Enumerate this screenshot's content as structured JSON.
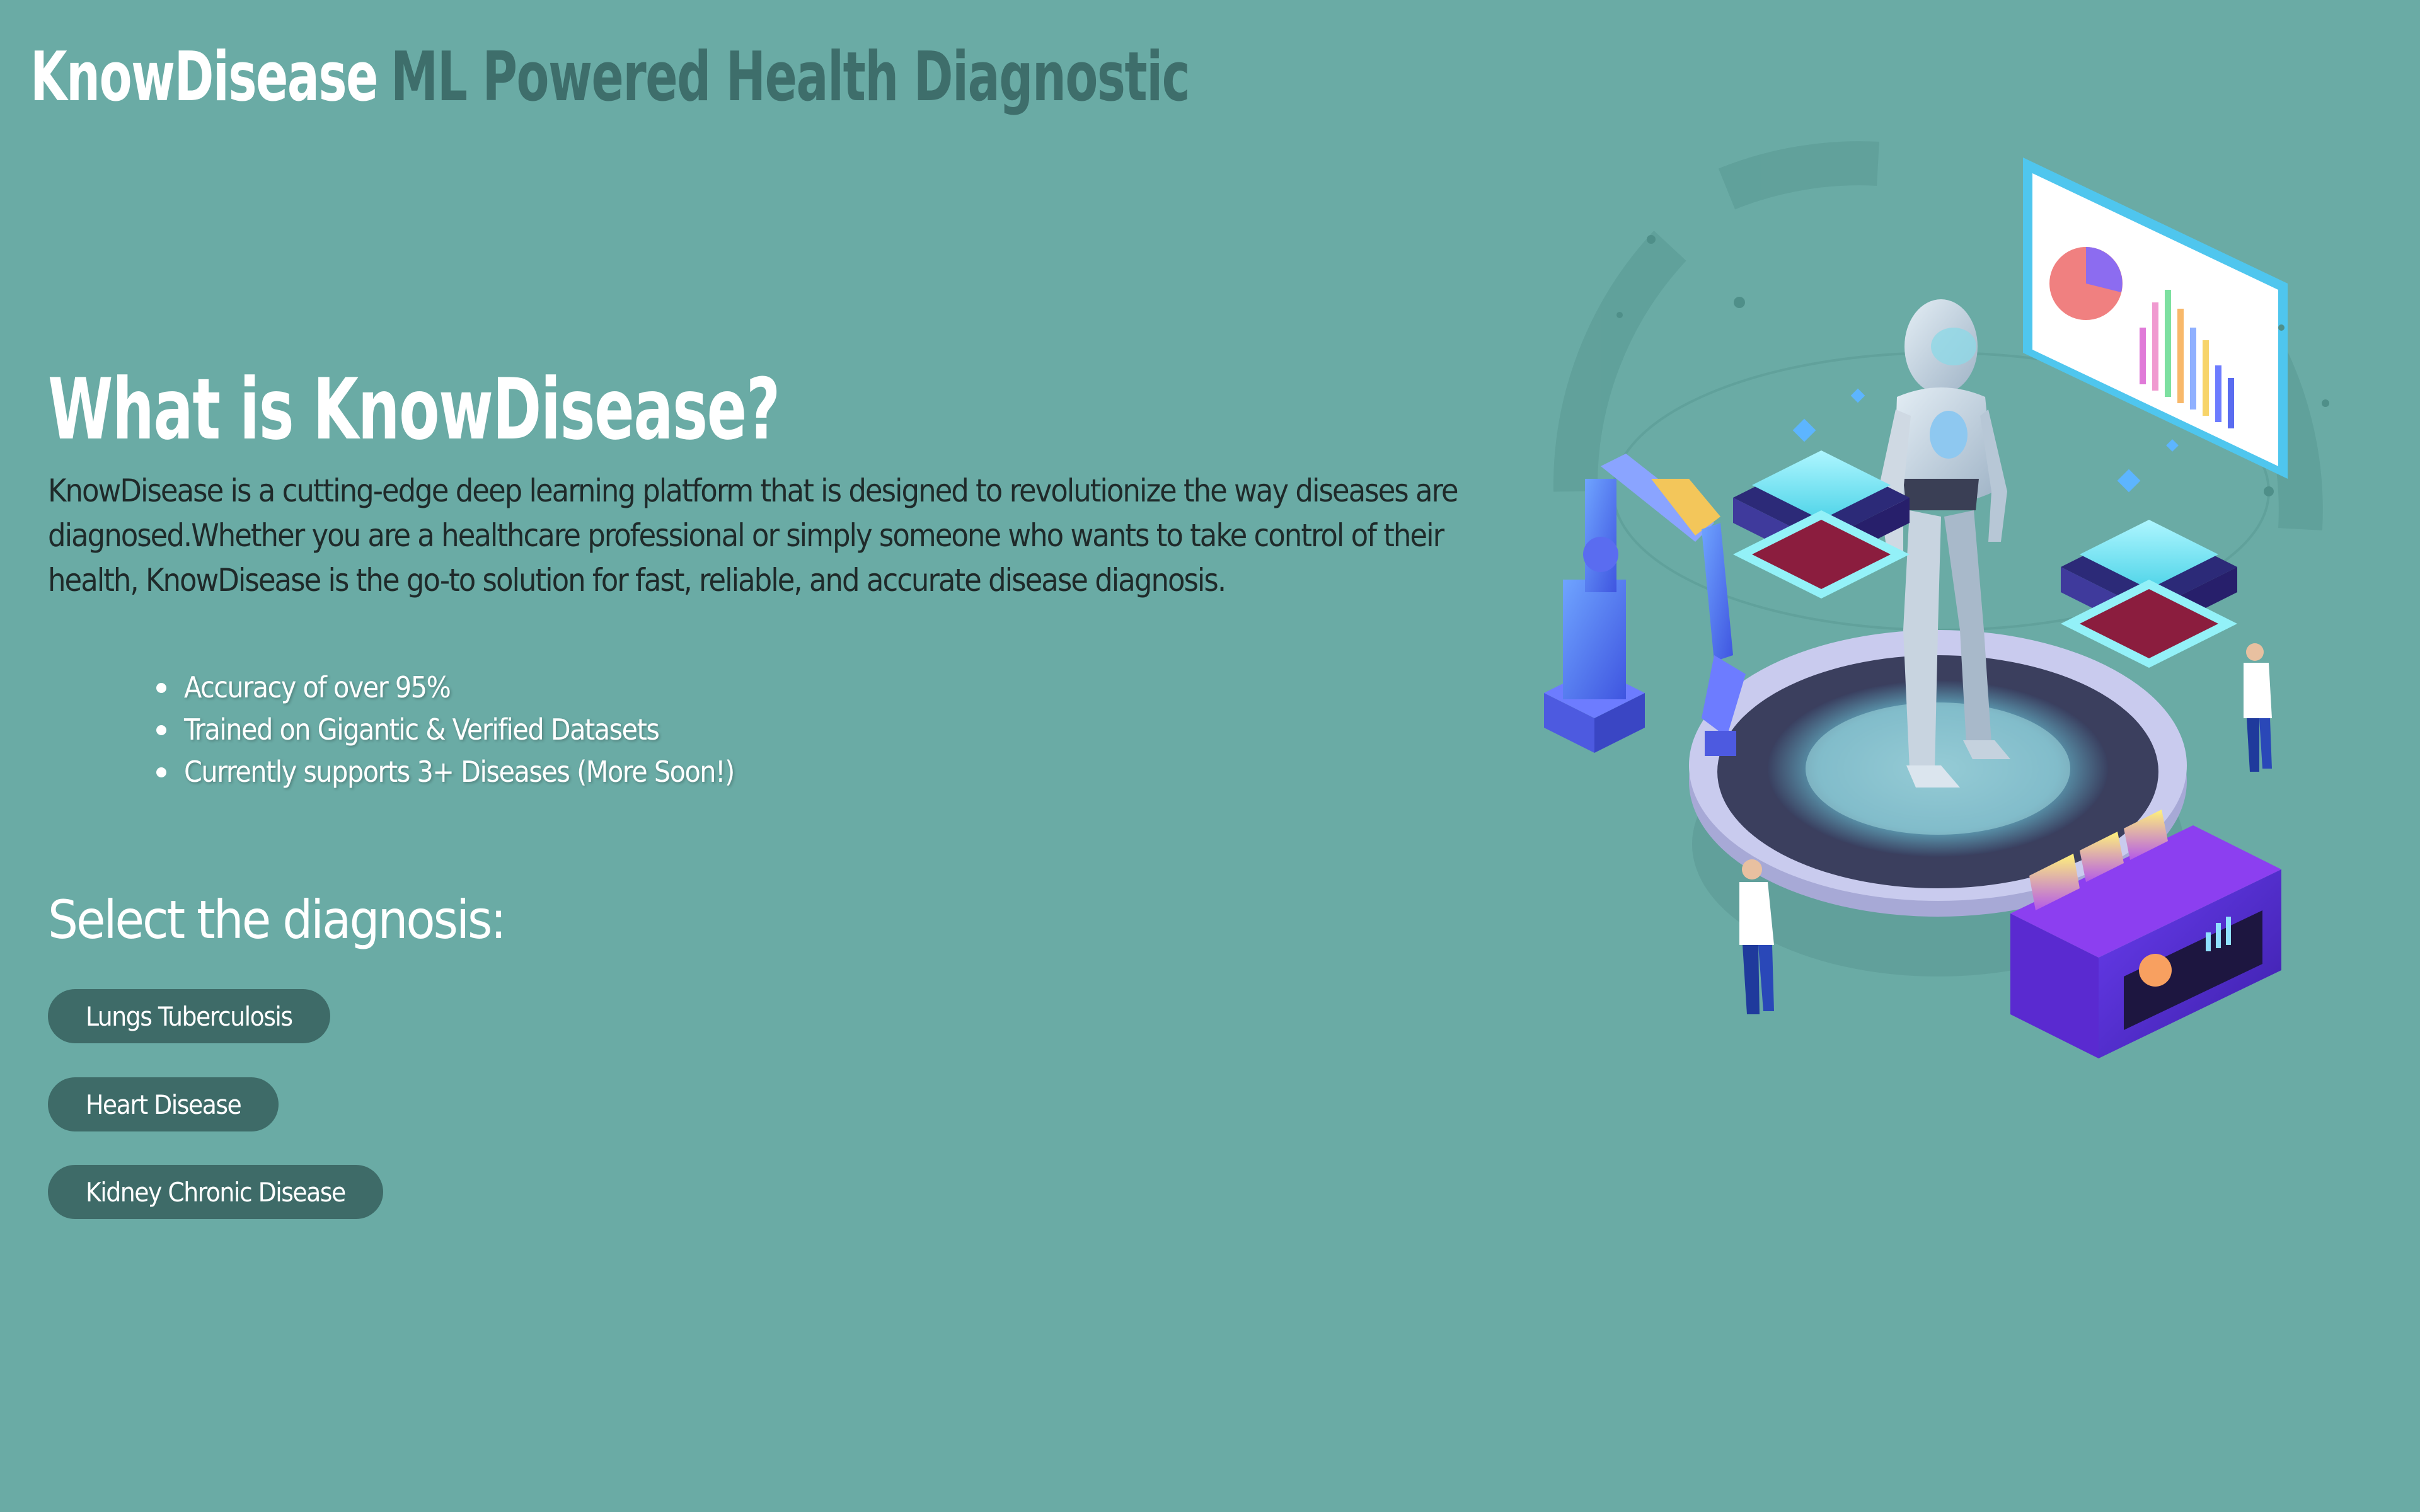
{
  "header": {
    "brand": "KnowDisease",
    "tagline": "ML Powered Health Diagnostic"
  },
  "intro": {
    "title": "What is KnowDisease?",
    "text": "KnowDisease is a cutting-edge deep learning platform that is designed to revolutionize the way diseases are diagnosed.Whether you are a healthcare professional or simply someone who wants to take control of their health, KnowDisease is the go-to solution for fast, reliable, and accurate disease diagnosis."
  },
  "features": [
    "Accuracy of over 95%",
    "Trained on Gigantic & Verified Datasets",
    "Currently supports 3+ Diseases (More Soon!)"
  ],
  "diagnosis": {
    "title": "Select the diagnosis:",
    "options": [
      "Lungs Tuberculosis",
      "Heart Disease",
      "Kidney Chronic Disease"
    ]
  },
  "colors": {
    "background": "#6aaba5",
    "brand": "#ffffff",
    "tagline": "#3e6e6b",
    "button": "#3e6b68"
  },
  "illustration": {
    "icon": "ai-robot-lab-illustration"
  }
}
